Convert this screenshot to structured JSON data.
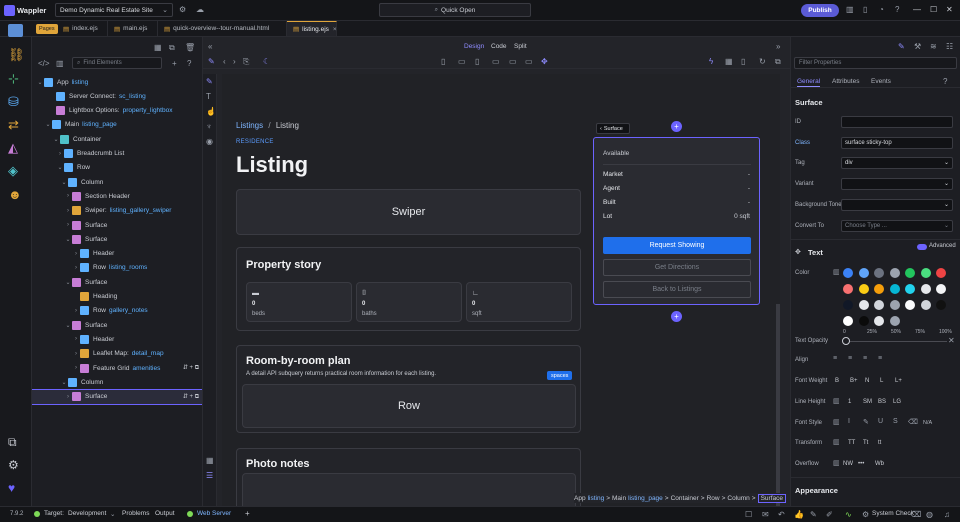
{
  "topbar": {
    "app_name": "Wappler",
    "project": "Demo Dynamic Real Estate Site",
    "quick_open": "Quick Open",
    "publish": "Publish"
  },
  "tabs": {
    "pages_badge": "Pages",
    "items": [
      "index.ejs",
      "main.ejs",
      "quick-overview--tour-manual.html",
      "listing.ejs"
    ]
  },
  "structure": {
    "search_placeholder": "Find Elements",
    "rows": [
      {
        "name": "App",
        "ref": "listing"
      },
      {
        "name": "Server Connect:",
        "ref": "sc_listing"
      },
      {
        "name": "Lightbox Options:",
        "ref": "property_lightbox"
      },
      {
        "name": "Main",
        "ref": "listing_page"
      },
      {
        "name": "Container",
        "ref": ""
      },
      {
        "name": "Breadcrumb List",
        "ref": ""
      },
      {
        "name": "Row",
        "ref": ""
      },
      {
        "name": "Column",
        "ref": ""
      },
      {
        "name": "Section Header",
        "ref": ""
      },
      {
        "name": "Swiper:",
        "ref": "listing_gallery_swiper"
      },
      {
        "name": "Surface",
        "ref": ""
      },
      {
        "name": "Surface",
        "ref": ""
      },
      {
        "name": "Header",
        "ref": ""
      },
      {
        "name": "Row",
        "ref": "listing_rooms"
      },
      {
        "name": "Surface",
        "ref": ""
      },
      {
        "name": "Heading",
        "ref": ""
      },
      {
        "name": "Row",
        "ref": "gallery_notes"
      },
      {
        "name": "Surface",
        "ref": ""
      },
      {
        "name": "Header",
        "ref": ""
      },
      {
        "name": "Leaflet Map:",
        "ref": "detail_map"
      },
      {
        "name": "Feature Grid",
        "ref": "amenities"
      },
      {
        "name": "Column",
        "ref": ""
      },
      {
        "name": "Surface",
        "ref": ""
      }
    ]
  },
  "canvas_toolbar": {
    "design": "Design",
    "code": "Code",
    "split": "Split"
  },
  "page": {
    "breadcrumb_home": "Listings",
    "breadcrumb_sep": "/",
    "breadcrumb_current": "Listing",
    "eyebrow": "RESIDENCE",
    "title": "Listing",
    "swiper": "Swiper",
    "story_title": "Property story",
    "stats": [
      {
        "value": "0",
        "label": "beds"
      },
      {
        "value": "0",
        "label": "baths"
      },
      {
        "value": "0",
        "label": "sqft"
      }
    ],
    "rooms_title": "Room-by-room plan",
    "rooms_desc": "A detail API subquery returns practical room information for each listing.",
    "rooms_badge": "spaces",
    "rooms_row": "Row",
    "photo_title": "Photo notes",
    "surface_tag": "Surface",
    "side_available": "Available",
    "side_items": [
      {
        "label": "Market",
        "value": "-"
      },
      {
        "label": "Agent",
        "value": "-"
      },
      {
        "label": "Built",
        "value": "-"
      },
      {
        "label": "Lot",
        "value": "0 sqft"
      }
    ],
    "btn_request": "Request Showing",
    "btn_directions": "Get Directions",
    "btn_back": "Back to Listings",
    "path": [
      {
        "name": "App",
        "ref": "listing"
      },
      {
        "name": "Main",
        "ref": "listing_page"
      },
      {
        "name": "Container",
        "ref": ""
      },
      {
        "name": "Row",
        "ref": ""
      },
      {
        "name": "Column",
        "ref": ""
      },
      {
        "name": "Surface",
        "ref": ""
      }
    ],
    "path_sep": ">"
  },
  "props": {
    "search_placeholder": "Filter Properties",
    "tabs": [
      "General",
      "Attributes",
      "Events"
    ],
    "section": "Surface",
    "id_label": "ID",
    "id_value": "",
    "class_label": "Class",
    "class_value": "surface sticky-top",
    "tag_label": "Tag",
    "tag_value": "div",
    "variant_label": "Variant",
    "variant_value": "",
    "bg_label": "Background Tone",
    "bg_value": "",
    "convert_label": "Convert To",
    "convert_placeholder": "Choose Type ...",
    "text_section": "Text",
    "advanced": "Advanced",
    "color_label": "Color",
    "colors": [
      "#3b82f6",
      "#60a5fa",
      "#6b7280",
      "#9ca3af",
      "#22c55e",
      "#4ade80",
      "#ef4444",
      "#f87171",
      "#facc15",
      "#f59e0b",
      "#06b6d4",
      "#22d3ee",
      "#e5e7eb",
      "#f3f4f6",
      "#111827",
      "#e5e7eb",
      "#d1d5db",
      "#9ca3af",
      "#f9fafb",
      "#d1d5db",
      "#111111",
      "#ffffff",
      "#0b0b0b",
      "#e5e7eb",
      "#9ca3af"
    ],
    "opacity_label": "Text Opacity",
    "opacity_ticks": [
      "0",
      "25%",
      "50%",
      "75%",
      "100%"
    ],
    "align_label": "Align",
    "weight_label": "Font Weight",
    "weights": [
      "B",
      "B+",
      "N",
      "L",
      "L+"
    ],
    "lh_label": "Line Height",
    "lh": [
      "1",
      "SM",
      "BS",
      "LG"
    ],
    "style_label": "Font Style",
    "style_na": "N/A",
    "transform_label": "Transform",
    "transforms": [
      "TT",
      "Tt",
      "tt"
    ],
    "overflow_label": "Overflow",
    "overflows": [
      "NW",
      "Wb"
    ],
    "appearance": "Appearance"
  },
  "status": {
    "version": "7.9.2",
    "target_label": "Target:",
    "target": "Development",
    "problems": "Problems",
    "output": "Output",
    "web_server": "Web Server",
    "system_check": "System Check"
  }
}
